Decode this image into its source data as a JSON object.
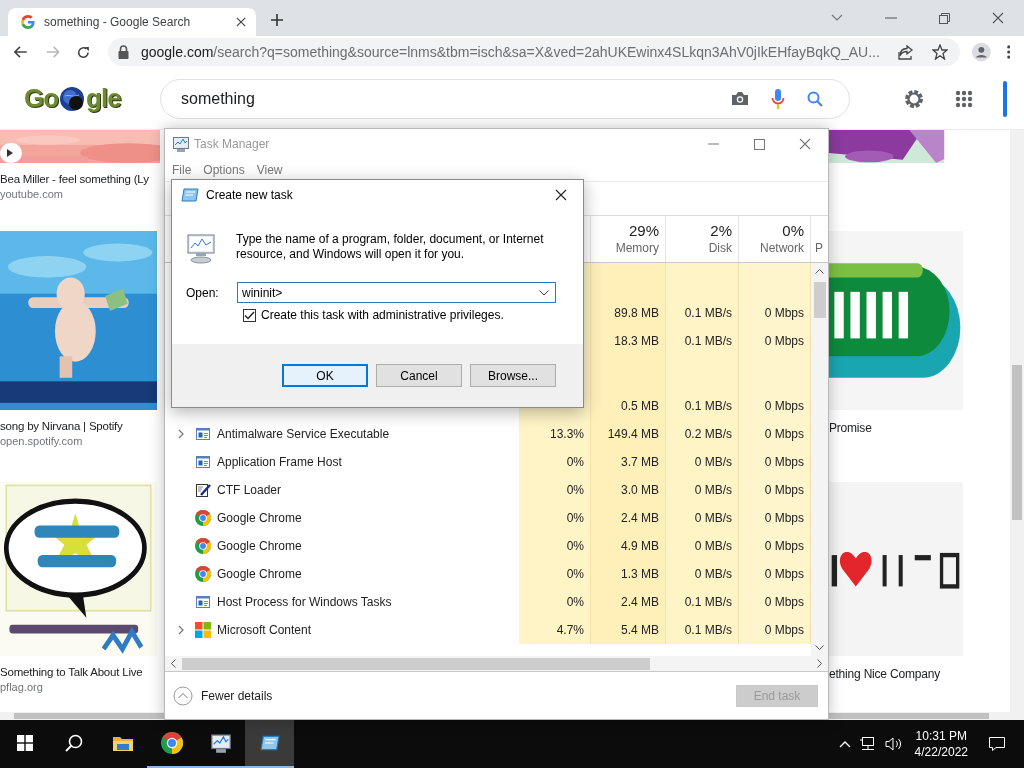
{
  "browser": {
    "tab": {
      "title": "something - Google Search",
      "selected": true
    },
    "back": {
      "disabled": false
    },
    "forward": {
      "disabled": true
    },
    "address": {
      "host": "google.com",
      "path": "/search?q=something&source=lnms&tbm=isch&sa=X&ved=2ahUKEwinx4SLkqn3AhV0jIkEHfayBqkQ_AU..."
    }
  },
  "google": {
    "logo": [
      "Go",
      "gle"
    ],
    "search": {
      "value": "something"
    }
  },
  "results": {
    "left": [
      {
        "kind": "picture",
        "video": true,
        "title": "Bea Miller - feel something (Ly",
        "source": "youtube.com"
      },
      {
        "kind": "picture",
        "video": false,
        "title": "song by Nirvana | Spotify",
        "source": "open.spotify.com"
      },
      {
        "kind": "picture",
        "video": false,
        "title": "Something to Talk About Live",
        "source": "pflag.org"
      }
    ],
    "right": [
      {
        "kind": "picture",
        "video": false
      },
      {
        "kind": "picture",
        "video": false,
        "title": "Promise"
      },
      {
        "kind": "picture",
        "video": false,
        "title": "ething Nice Company"
      }
    ]
  },
  "task_manager": {
    "title": "Task Manager",
    "active": false,
    "menu": [
      "File",
      "Options",
      "View"
    ],
    "columns": [
      {
        "percent": "29%",
        "label": "Memory"
      },
      {
        "percent": "2%",
        "label": "Disk"
      },
      {
        "percent": "0%",
        "label": "Network"
      },
      {
        "label": "P"
      }
    ],
    "rows": [
      {
        "kind": "group"
      },
      {
        "kind": "process",
        "memory": "89.8 MB",
        "disk": "0.1 MB/s",
        "network": "0 Mbps"
      },
      {
        "kind": "process",
        "memory": "18.3 MB",
        "disk": "0.1 MB/s",
        "network": "0 Mbps"
      },
      {
        "kind": "group"
      },
      {
        "kind": "process",
        "memory": "0.5 MB",
        "disk": "0.1 MB/s",
        "network": "0 Mbps"
      },
      {
        "kind": "app",
        "expandable": true,
        "name": "Antimalware Service Executable",
        "cpu": "13.3%",
        "memory": "149.4 MB",
        "disk": "0.2 MB/s",
        "network": "0 Mbps"
      },
      {
        "kind": "app",
        "expandable": false,
        "name": "Application Frame Host",
        "cpu": "0%",
        "memory": "3.7 MB",
        "disk": "0 MB/s",
        "network": "0 Mbps"
      },
      {
        "kind": "editor",
        "expandable": false,
        "name": "CTF Loader",
        "cpu": "0%",
        "memory": "3.0 MB",
        "disk": "0 MB/s",
        "network": "0 Mbps"
      },
      {
        "kind": "browser",
        "expandable": false,
        "name": "Google Chrome",
        "cpu": "0%",
        "memory": "2.4 MB",
        "disk": "0 MB/s",
        "network": "0 Mbps"
      },
      {
        "kind": "browser",
        "expandable": false,
        "name": "Google Chrome",
        "cpu": "0%",
        "memory": "4.9 MB",
        "disk": "0 MB/s",
        "network": "0 Mbps"
      },
      {
        "kind": "browser",
        "expandable": false,
        "name": "Google Chrome",
        "cpu": "0%",
        "memory": "1.3 MB",
        "disk": "0 MB/s",
        "network": "0 Mbps"
      },
      {
        "kind": "app",
        "expandable": false,
        "name": "Host Process for Windows Tasks",
        "cpu": "0%",
        "memory": "2.4 MB",
        "disk": "0.1 MB/s",
        "network": "0 Mbps"
      },
      {
        "kind": "store",
        "expandable": true,
        "name": "Microsoft Content",
        "cpu": "4.7%",
        "memory": "5.4 MB",
        "disk": "0.1 MB/s",
        "network": "0 Mbps"
      }
    ],
    "fewer_details": "Fewer details",
    "end_task": {
      "label": "End task",
      "disabled": true
    }
  },
  "dialog": {
    "title": "Create new task",
    "message": "Type the name of a program, folder, document, or Internet resource, and Windows will open it for you.",
    "open_label": "Open:",
    "value": "wininit>",
    "admin": {
      "label": "Create this task with administrative privileges.",
      "checked": true
    },
    "buttons": [
      {
        "label": "OK",
        "default": true
      },
      {
        "label": "Cancel",
        "default": false
      },
      {
        "label": "Browse...",
        "default": false
      }
    ]
  },
  "taskbar": {
    "apps": [
      {
        "kind": "folder",
        "running": false,
        "active": false
      },
      {
        "kind": "chrome",
        "running": true,
        "active": false
      },
      {
        "kind": "monitor",
        "running": true,
        "active": false
      },
      {
        "kind": "run",
        "running": true,
        "active": true
      }
    ],
    "time": "10:31 PM",
    "date": "4/22/2022"
  }
}
